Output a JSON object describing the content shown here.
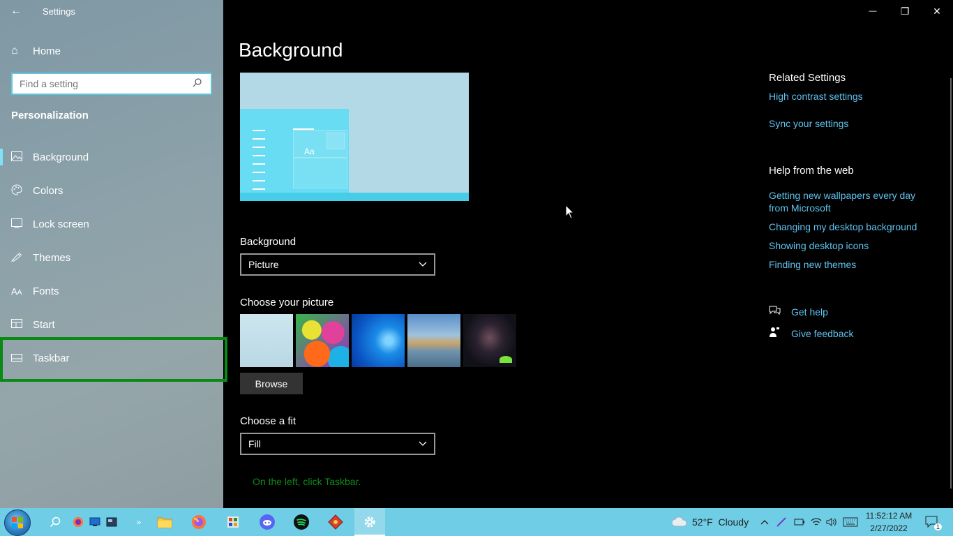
{
  "window": {
    "title": "Settings",
    "back_icon": "←",
    "minimize_icon": "—",
    "restore_icon": "❐",
    "close_icon": "✕"
  },
  "sidebar": {
    "home_label": "Home",
    "search_placeholder": "Find a setting",
    "section_title": "Personalization",
    "items": [
      {
        "label": "Background",
        "icon": "picture-icon",
        "active": true
      },
      {
        "label": "Colors",
        "icon": "palette-icon",
        "active": false
      },
      {
        "label": "Lock screen",
        "icon": "lock-screen-icon",
        "active": false
      },
      {
        "label": "Themes",
        "icon": "themes-icon",
        "active": false
      },
      {
        "label": "Fonts",
        "icon": "fonts-icon",
        "active": false
      },
      {
        "label": "Start",
        "icon": "start-icon",
        "active": false
      },
      {
        "label": "Taskbar",
        "icon": "taskbar-icon",
        "active": false
      }
    ]
  },
  "main": {
    "title": "Background",
    "preview_text": "Aa",
    "background_label": "Background",
    "background_value": "Picture",
    "choose_picture_label": "Choose your picture",
    "browse_label": "Browse",
    "choose_fit_label": "Choose a fit",
    "fit_value": "Fill",
    "instruction": "On the left, click Taskbar."
  },
  "related": {
    "heading": "Related Settings",
    "links": [
      "High contrast settings",
      "Sync your settings"
    ]
  },
  "help": {
    "heading": "Help from the web",
    "links": [
      "Getting new wallpapers every day from Microsoft",
      "Changing my desktop background",
      "Showing desktop icons",
      "Finding new themes"
    ],
    "get_help": "Get help",
    "give_feedback": "Give feedback"
  },
  "taskbar": {
    "weather": "52°F  Cloudy",
    "time": "11:52:12 AM",
    "date": "2/27/2022",
    "notification_count": "1",
    "colors": {
      "taskbar": "#6fcde5",
      "accent": "#5fc3f0",
      "highlight": "#0a8a14"
    }
  }
}
